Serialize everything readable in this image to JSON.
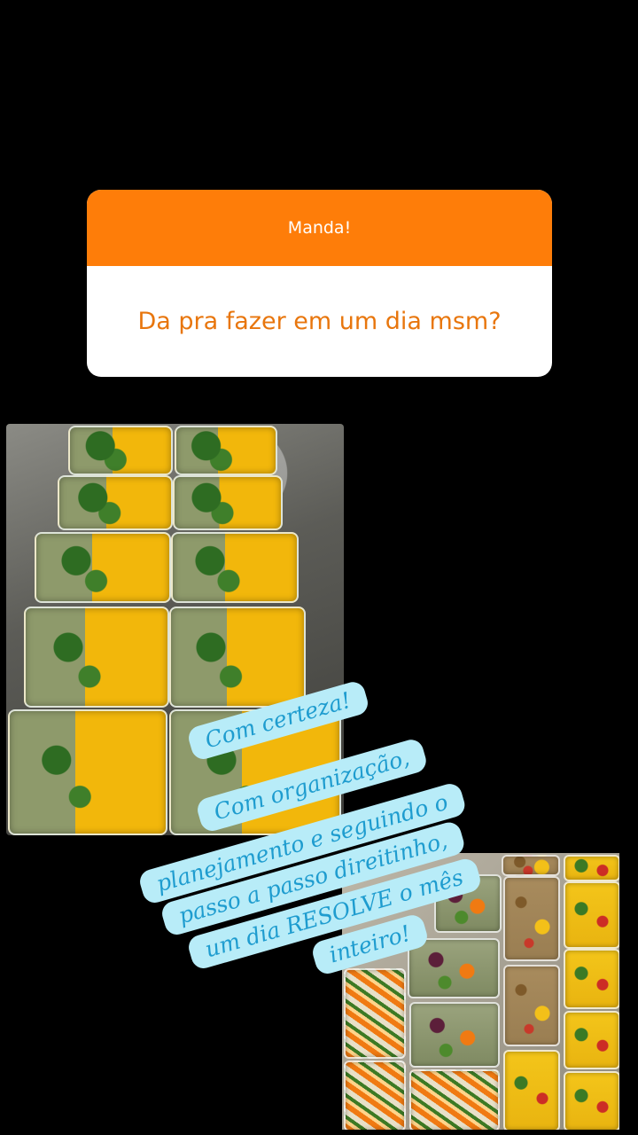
{
  "question": {
    "header": "Manda!",
    "text": "Da pra fazer em um dia msm?",
    "header_color": "#fe7d09",
    "text_color": "#e8760d"
  },
  "answer": {
    "lines": [
      "Com certeza!",
      "Com organização,",
      "planejamento e seguindo o",
      "passo a passo direitinho,",
      "um dia RESOLVE o mês",
      "inteiro!"
    ],
    "strip_color": "#b8ecf8",
    "text_color": "#1e9ccf"
  },
  "photos": [
    {
      "subject": "meal-prep-containers-greens-mango"
    },
    {
      "subject": "meal-prep-containers-grains-vegetables"
    }
  ]
}
